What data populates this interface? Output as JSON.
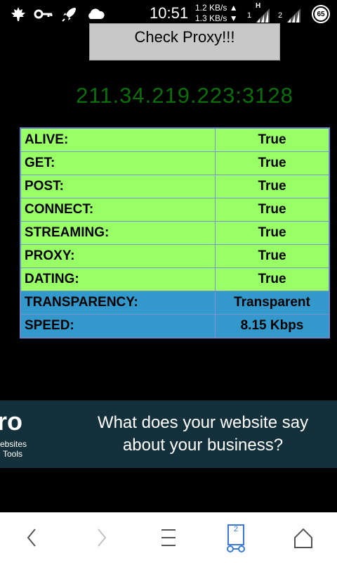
{
  "status_bar": {
    "time": "10:51",
    "upload_rate": "1.2 KB/s ▲",
    "download_rate": "1.3 KB/s ▼",
    "sim1_label": "1",
    "network_type": "H",
    "sim2_label": "2",
    "battery": "65",
    "icons": [
      "maple-leaf-icon",
      "key-icon",
      "rocket-icon",
      "cloud-icon",
      "signal-icon",
      "battery-icon"
    ]
  },
  "toolbar": {
    "check_label": "Check Proxy!!!"
  },
  "proxy": {
    "address": "211.34.219.223:3128"
  },
  "results": {
    "rows": [
      {
        "key": "ALIVE:",
        "value": "True",
        "color": "#99ff66"
      },
      {
        "key": "GET:",
        "value": "True",
        "color": "#99ff66"
      },
      {
        "key": "POST:",
        "value": "True",
        "color": "#99ff66"
      },
      {
        "key": "CONNECT:",
        "value": "True",
        "color": "#99ff66"
      },
      {
        "key": "STREAMING:",
        "value": "True",
        "color": "#99ff66"
      },
      {
        "key": "PROXY:",
        "value": "True",
        "color": "#99ff66"
      },
      {
        "key": "DATING:",
        "value": "True",
        "color": "#99ff66"
      },
      {
        "key": "TRANSPARENCY:",
        "value": "Transparent",
        "color": "#3399cc"
      },
      {
        "key": "SPEED:",
        "value": "8.15 Kbps",
        "color": "#3399cc"
      }
    ]
  },
  "ad": {
    "logo_text": "ro",
    "sub_text_1": "ebsites",
    "sub_text_2": "Tools",
    "headline": "What does your website say about your business?",
    "background": "#14313b"
  },
  "navbar": {
    "tab_count": "2",
    "icons": [
      "back-icon",
      "forward-icon",
      "menu-icon",
      "tabs-icon",
      "home-icon"
    ]
  }
}
